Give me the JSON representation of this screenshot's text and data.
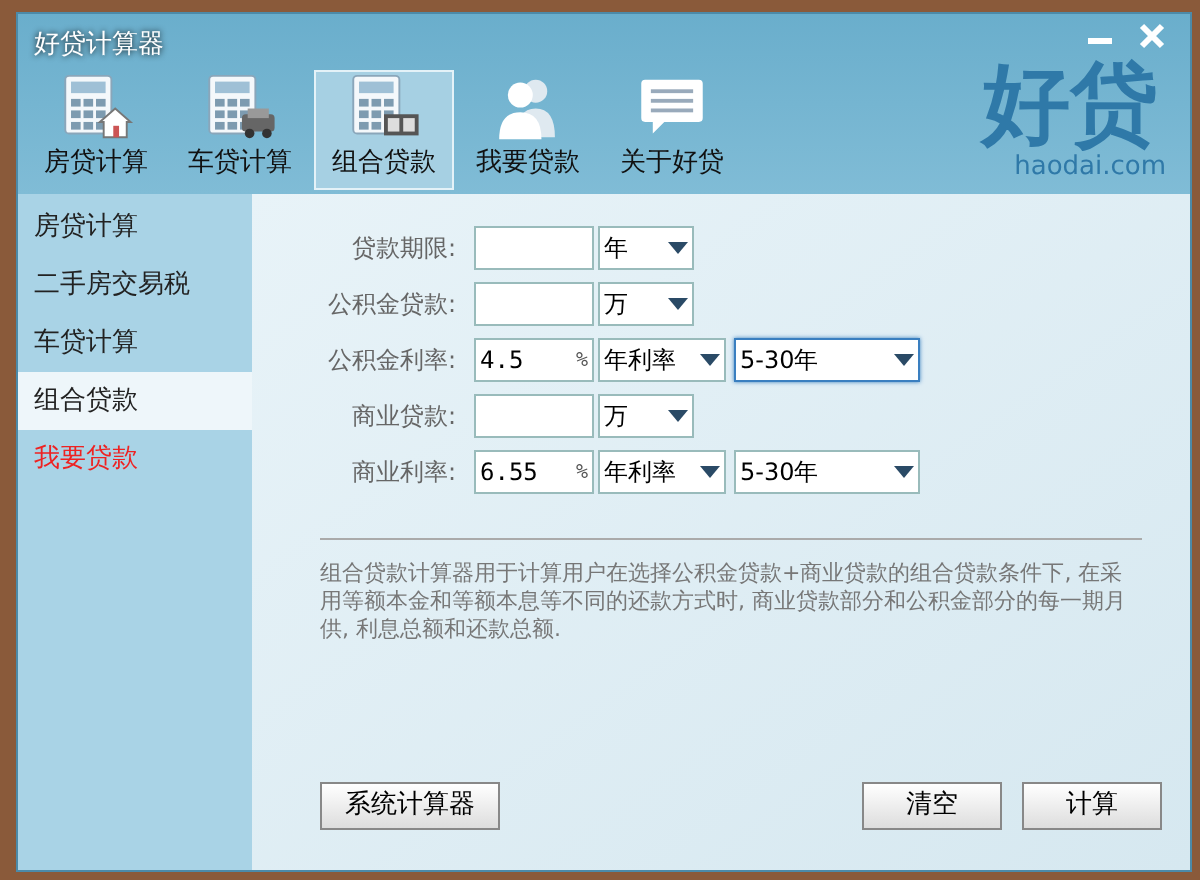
{
  "window": {
    "title": "好贷计算器"
  },
  "toolbar": [
    {
      "label": "房贷计算",
      "selected": false
    },
    {
      "label": "车贷计算",
      "selected": false
    },
    {
      "label": "组合贷款",
      "selected": true
    },
    {
      "label": "我要贷款",
      "selected": false
    },
    {
      "label": "关于好贷",
      "selected": false
    }
  ],
  "logo": {
    "name": "好贷",
    "site": "haodai.com"
  },
  "sidebar": [
    {
      "label": "房贷计算",
      "selected": false,
      "color": "#222222"
    },
    {
      "label": "二手房交易税",
      "selected": false,
      "color": "#222222"
    },
    {
      "label": "车贷计算",
      "selected": false,
      "color": "#222222"
    },
    {
      "label": "组合贷款",
      "selected": true,
      "color": "#222222"
    },
    {
      "label": "我要贷款",
      "selected": false,
      "color": "#ee2222"
    }
  ],
  "form": [
    {
      "label": "贷款期限:",
      "selects": [
        {
          "value": "年",
          "focused": false
        }
      ]
    },
    {
      "label": "公积金贷款:",
      "selects": [
        {
          "value": "万",
          "focused": false
        }
      ]
    },
    {
      "label": "公积金利率:",
      "input": {
        "value": "4.5",
        "suffix": "%"
      },
      "selects": [
        {
          "value": "年利率",
          "focused": false
        },
        {
          "value": "5-30年",
          "focused": true
        }
      ]
    },
    {
      "label": "商业贷款:",
      "selects": [
        {
          "value": "万",
          "focused": false
        }
      ]
    },
    {
      "label": "商业利率:",
      "input": {
        "value": "6.55",
        "suffix": "%"
      },
      "selects": [
        {
          "value": "年利率",
          "focused": false
        },
        {
          "value": "5-30年",
          "focused": false
        }
      ]
    }
  ],
  "description": "组合贷款计算器用于计算用户在选择公积金贷款+商业贷款的组合贷款条件下, 在采用等额本金和等额本息等不同的还款方式时, 商业贷款部分和公积金部分的每一期月供, 利息总额和还款总额.",
  "buttons": {
    "left": [
      "系统计算器"
    ],
    "right": [
      "清空",
      "计算"
    ]
  }
}
